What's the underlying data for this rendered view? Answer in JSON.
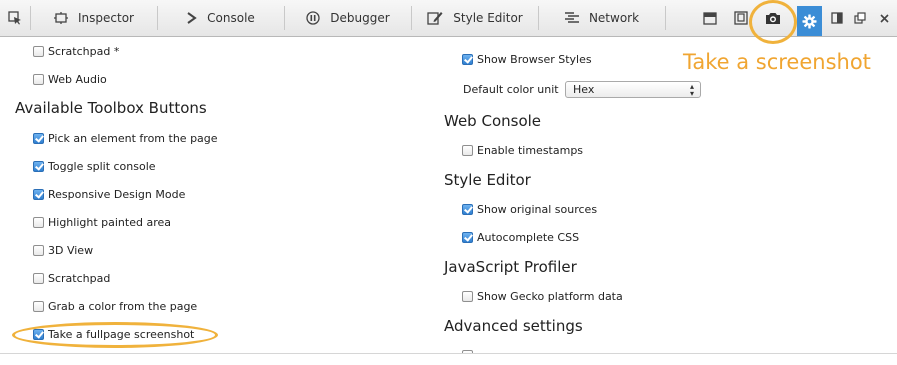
{
  "toolbar": {
    "tabs": [
      {
        "label": "Inspector"
      },
      {
        "label": "Console"
      },
      {
        "label": "Debugger"
      },
      {
        "label": "Style Editor"
      },
      {
        "label": "Network"
      }
    ]
  },
  "left": {
    "options_top": [
      {
        "label": "Scratchpad *",
        "checked": false
      },
      {
        "label": "Web Audio",
        "checked": false
      }
    ],
    "section_title": "Available Toolbox Buttons",
    "toolbox_buttons": [
      {
        "label": "Pick an element from the page",
        "checked": true
      },
      {
        "label": "Toggle split console",
        "checked": true
      },
      {
        "label": "Responsive Design Mode",
        "checked": true
      },
      {
        "label": "Highlight painted area",
        "checked": false
      },
      {
        "label": "3D View",
        "checked": false
      },
      {
        "label": "Scratchpad",
        "checked": false
      },
      {
        "label": "Grab a color from the page",
        "checked": false
      },
      {
        "label": "Take a fullpage screenshot",
        "checked": true
      }
    ]
  },
  "right": {
    "show_browser_styles": {
      "label": "Show Browser Styles",
      "checked": true
    },
    "default_color_unit": {
      "label": "Default color unit",
      "value": "Hex"
    },
    "web_console": {
      "title": "Web Console",
      "options": [
        {
          "label": "Enable timestamps",
          "checked": false
        }
      ]
    },
    "style_editor": {
      "title": "Style Editor",
      "options": [
        {
          "label": "Show original sources",
          "checked": true
        },
        {
          "label": "Autocomplete CSS",
          "checked": true
        }
      ]
    },
    "js_profiler": {
      "title": "JavaScript Profiler",
      "options": [
        {
          "label": "Show Gecko platform data",
          "checked": false
        }
      ]
    },
    "advanced": {
      "title": "Advanced settings"
    }
  },
  "annotation": {
    "text": "Take a screenshot",
    "color": "#f0a531"
  },
  "colors": {
    "accent": "#3b8dd6",
    "highlight": "#f0b23c"
  }
}
